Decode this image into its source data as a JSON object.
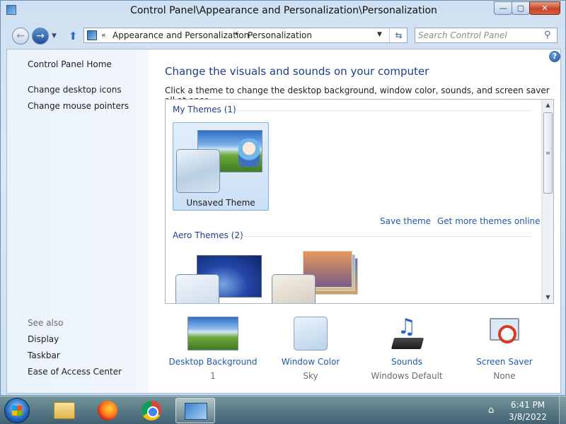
{
  "window": {
    "title": "Control Panel\\Appearance and Personalization\\Personalization",
    "controls": {
      "minimize": "—",
      "maximize": "▢",
      "close": "✕"
    }
  },
  "address_bar": {
    "chevron": "«",
    "crumbs": [
      "Appearance and Personalization",
      "Personalization"
    ],
    "separator": "▸",
    "dropdown": "▼",
    "refresh": "⇆"
  },
  "nav": {
    "back": "←",
    "forward": "→",
    "history_drop": "▼",
    "up": "⬆"
  },
  "search": {
    "placeholder": "Search Control Panel",
    "value": "",
    "icon": "search-icon"
  },
  "sidebar": {
    "items": [
      "Control Panel Home",
      "Change desktop icons",
      "Change mouse pointers"
    ],
    "see_also": "See also",
    "see_also_items": [
      "Display",
      "Taskbar",
      "Ease of Access Center"
    ]
  },
  "main": {
    "help": "?",
    "title": "Change the visuals and sounds on your computer",
    "description": "Click a theme to change the desktop background, window color, sounds, and screen saver all at once.",
    "groups": [
      {
        "header": "My Themes (1)",
        "themes": [
          {
            "label": "Unsaved Theme",
            "selected": true
          }
        ]
      },
      {
        "header": "Aero Themes (2)",
        "themes": [
          {
            "label": ""
          },
          {
            "label": ""
          }
        ]
      }
    ],
    "links": {
      "save_theme": "Save theme",
      "get_more": "Get more themes online"
    },
    "scrollbar": {
      "up": "▲",
      "down": "▼",
      "grip": "≡"
    }
  },
  "bottom": [
    {
      "label": "Desktop Background",
      "value": "1"
    },
    {
      "label": "Window Color",
      "value": "Sky"
    },
    {
      "label": "Sounds",
      "value": "Windows Default"
    },
    {
      "label": "Screen Saver",
      "value": "None"
    }
  ],
  "taskbar": {
    "apps": [
      "windows-explorer",
      "firefox",
      "chrome",
      "control-panel"
    ],
    "active_app": "control-panel",
    "tray_icon": "⌂",
    "time": "6:41 PM",
    "date": "3/8/2022"
  },
  "colors": {
    "accent_link": "#1f5aa6",
    "heading": "#1e3c8c",
    "close_button": "#c6442a"
  }
}
